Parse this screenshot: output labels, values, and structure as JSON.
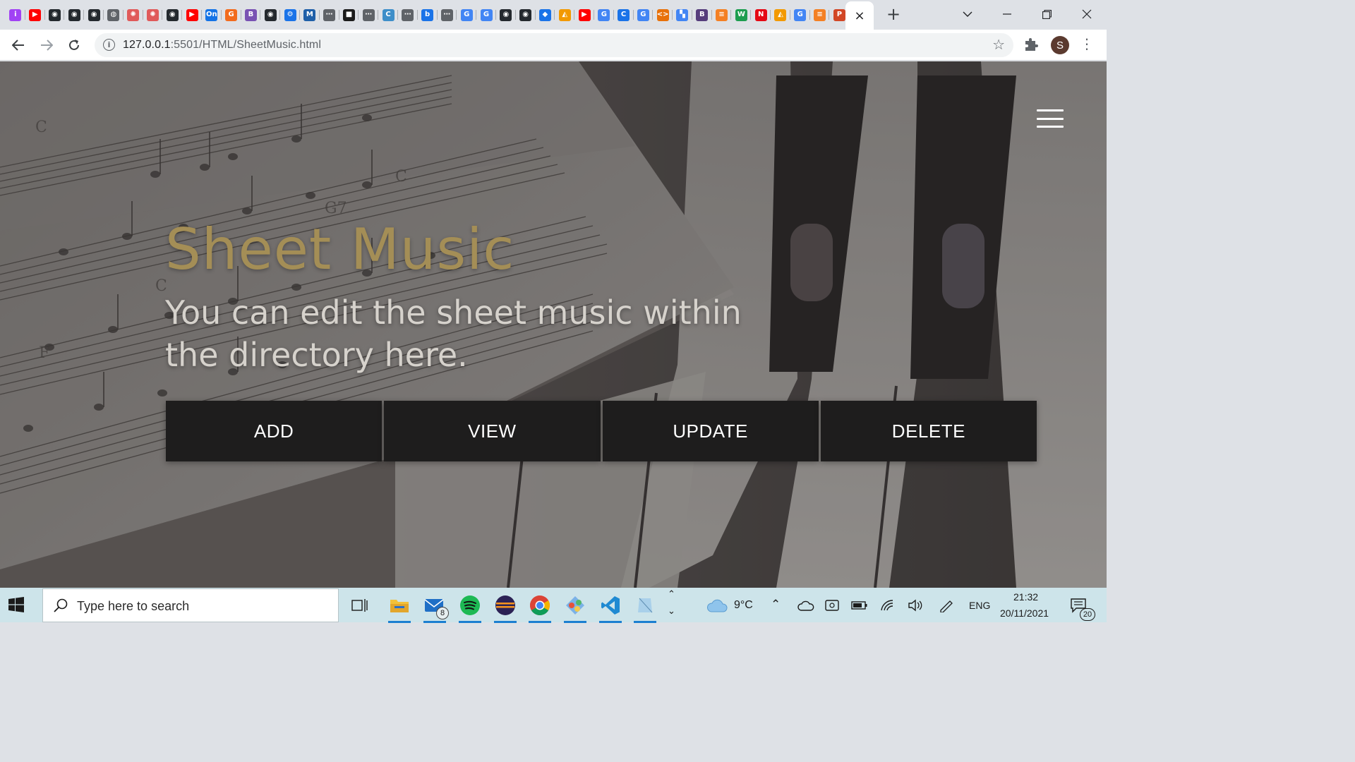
{
  "browser": {
    "tab_favicons": [
      {
        "icon": "tab-favicon-purple",
        "glyph": "i",
        "color": "#a142f4"
      },
      {
        "icon": "tab-favicon-youtube",
        "glyph": "▶",
        "color": "#ff0000"
      },
      {
        "icon": "tab-favicon-github",
        "glyph": "◉",
        "color": "#24292e"
      },
      {
        "icon": "tab-favicon-github",
        "glyph": "◉",
        "color": "#24292e"
      },
      {
        "icon": "tab-favicon-github",
        "glyph": "◉",
        "color": "#24292e"
      },
      {
        "icon": "tab-favicon-globe",
        "glyph": "◍",
        "color": "#5f6368"
      },
      {
        "icon": "tab-favicon-openai",
        "glyph": "✺",
        "color": "#e05a5a"
      },
      {
        "icon": "tab-favicon-openai",
        "glyph": "✺",
        "color": "#e05a5a"
      },
      {
        "icon": "tab-favicon-github",
        "glyph": "◉",
        "color": "#24292e"
      },
      {
        "icon": "tab-favicon-youtube",
        "glyph": "▶",
        "color": "#ff0000"
      },
      {
        "icon": "tab-favicon-on",
        "glyph": "On",
        "color": "#1473e6"
      },
      {
        "icon": "tab-favicon-g-orange",
        "glyph": "G",
        "color": "#f26b1d"
      },
      {
        "icon": "tab-favicon-b-purple",
        "glyph": "B",
        "color": "#7952b3"
      },
      {
        "icon": "tab-favicon-github",
        "glyph": "◉",
        "color": "#24292e"
      },
      {
        "icon": "tab-favicon-gear",
        "glyph": "⚙",
        "color": "#1a73e8"
      },
      {
        "icon": "tab-favicon-mvn",
        "glyph": "M",
        "color": "#1f5fa8"
      },
      {
        "icon": "tab-favicon-dots",
        "glyph": "⋯",
        "color": "#5f6368"
      },
      {
        "icon": "tab-favicon-black",
        "glyph": "■",
        "color": "#1b1b1b"
      },
      {
        "icon": "tab-favicon-dots",
        "glyph": "⋯",
        "color": "#5f6368"
      },
      {
        "icon": "tab-favicon-c",
        "glyph": "C",
        "color": "#3d8ec9"
      },
      {
        "icon": "tab-favicon-dots",
        "glyph": "⋯",
        "color": "#5f6368"
      },
      {
        "icon": "tab-favicon-bing",
        "glyph": "b",
        "color": "#1a73e8"
      },
      {
        "icon": "tab-favicon-dots",
        "glyph": "⋯",
        "color": "#5f6368"
      },
      {
        "icon": "tab-favicon-google",
        "glyph": "G",
        "color": "#4285f4"
      },
      {
        "icon": "tab-favicon-google",
        "glyph": "G",
        "color": "#4285f4"
      },
      {
        "icon": "tab-favicon-github",
        "glyph": "◉",
        "color": "#24292e"
      },
      {
        "icon": "tab-favicon-github",
        "glyph": "◉",
        "color": "#24292e"
      },
      {
        "icon": "tab-favicon-diamond",
        "glyph": "◆",
        "color": "#1a73e8"
      },
      {
        "icon": "tab-favicon-orange",
        "glyph": "◭",
        "color": "#f29900"
      },
      {
        "icon": "tab-favicon-youtube",
        "glyph": "▶",
        "color": "#ff0000"
      },
      {
        "icon": "tab-favicon-google",
        "glyph": "G",
        "color": "#4285f4"
      },
      {
        "icon": "tab-favicon-c-blue",
        "glyph": "C",
        "color": "#1a73e8"
      },
      {
        "icon": "tab-favicon-google",
        "glyph": "G",
        "color": "#4285f4"
      },
      {
        "icon": "tab-favicon-code",
        "glyph": "<>",
        "color": "#e8710a"
      },
      {
        "icon": "tab-favicon-multicolor",
        "glyph": "▚",
        "color": "#4285f4"
      },
      {
        "icon": "tab-favicon-b-dark",
        "glyph": "B",
        "color": "#563d7c"
      },
      {
        "icon": "tab-favicon-stackoverflow",
        "glyph": "≡",
        "color": "#f48024"
      },
      {
        "icon": "tab-favicon-w",
        "glyph": "W",
        "color": "#1d9d4f"
      },
      {
        "icon": "tab-favicon-netflix",
        "glyph": "N",
        "color": "#e50914"
      },
      {
        "icon": "tab-favicon-orange",
        "glyph": "◭",
        "color": "#f29900"
      },
      {
        "icon": "tab-favicon-google",
        "glyph": "G",
        "color": "#4285f4"
      },
      {
        "icon": "tab-favicon-stackoverflow",
        "glyph": "≡",
        "color": "#f48024"
      },
      {
        "icon": "tab-favicon-powerpoint",
        "glyph": "P",
        "color": "#d24726"
      }
    ],
    "active_tab_close": "×",
    "new_tab": "+",
    "url_host": "127.0.0.1",
    "url_rest": ":5501/HTML/SheetMusic.html",
    "profile_initial": "S"
  },
  "page": {
    "title": "Sheet Music",
    "subtitle": "You can edit the sheet music within the directory here.",
    "buttons": [
      "ADD",
      "VIEW",
      "UPDATE",
      "DELETE"
    ],
    "colors": {
      "title": "#a48e56",
      "button_bg": "#1e1d1d"
    }
  },
  "taskbar": {
    "search_placeholder": "Type here to search",
    "mail_badge": "8",
    "weather_temp": "9°C",
    "language": "ENG",
    "time": "21:32",
    "date": "20/11/2021",
    "notifications_count": "20"
  }
}
